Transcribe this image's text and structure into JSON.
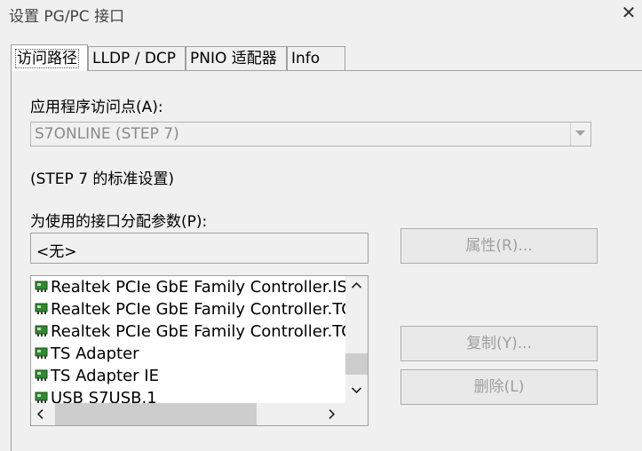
{
  "window": {
    "title": "设置 PG/PC 接口",
    "close_glyph": "✕"
  },
  "tabs": [
    {
      "label": "访问路径"
    },
    {
      "label": "LLDP / DCP"
    },
    {
      "label": "PNIO 适配器"
    },
    {
      "label": "Info"
    }
  ],
  "access_point": {
    "label": "应用程序访问点(A):",
    "value": "S7ONLINE (STEP 7)",
    "note": "(STEP 7 的标准设置)"
  },
  "interface": {
    "label": "为使用的接口分配参数(P):",
    "value": "<无>"
  },
  "buttons": {
    "properties": "属性(R)...",
    "copy": "复制(Y)...",
    "delete": "删除(L)"
  },
  "interface_list": [
    "Realtek PCIe GbE Family Controller.ISO",
    "Realtek PCIe GbE Family Controller.TCP",
    "Realtek PCIe GbE Family Controller.TCP",
    "TS Adapter",
    "TS Adapter IE",
    "USB S7USB.1"
  ],
  "icon_color": "#2e8b2e",
  "disabled_text_color": "#a0a0a0"
}
